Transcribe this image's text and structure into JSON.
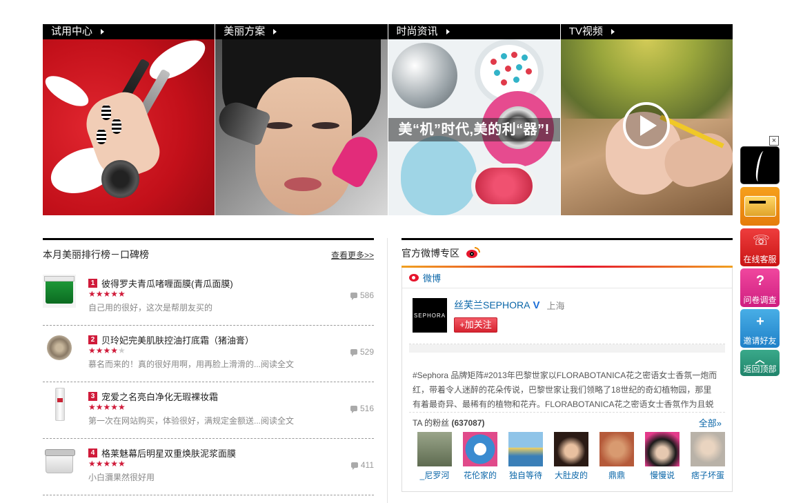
{
  "tiles": [
    {
      "label": "试用中心"
    },
    {
      "label": "美丽方案"
    },
    {
      "label": "时尚资讯",
      "caption": "美“机”时代,美的利“器”!"
    },
    {
      "label": "TV视频"
    }
  ],
  "ranking": {
    "title": "本月美丽排行榜－口碑榜",
    "more": "查看更多>>",
    "items": [
      {
        "rank": "1",
        "name": "彼得罗夫青瓜啫喱面膜(青瓜面膜)",
        "stars_on": "★★★★★",
        "stars_off": "",
        "desc": "自己用的很好，这次是帮朋友买的",
        "count": "586"
      },
      {
        "rank": "2",
        "name": "贝玲妃完美肌肤控油打底霜（猪油膏）",
        "stars_on": "★★★★",
        "stars_off": "★",
        "desc": "慕名而来的！真的很好用啊，用再脸上滑滑的...阅读全文",
        "count": "529"
      },
      {
        "rank": "3",
        "name": "宠爱之名亮白净化无瑕裸妆霜",
        "stars_on": "★★★★★",
        "stars_off": "",
        "desc": "第一次在网站购买，体验很好，满规定金额送...阅读全文",
        "count": "516"
      },
      {
        "rank": "4",
        "name": "格莱魅幕后明星双重焕肤泥浆面膜",
        "stars_on": "★★★★★",
        "stars_off": "",
        "desc": "小白瀰果然很好用",
        "count": "411"
      }
    ]
  },
  "weibo": {
    "title": "官方微博专区",
    "sub_label": "微博",
    "profile": {
      "avatar_text": "SEPHORA",
      "name": "丝芙兰SEPHORA",
      "vip": "V",
      "location": "上海",
      "follow": "+加关注"
    },
    "feed_text": "#Sephora 品牌矩阵#2013年巴黎世家以FLORABOTANICA花之密语女士香氛一炮而红，带着令人迷醉的花朵传说，巴黎世家让我们领略了18世纪的奇幻植物园，那里有着最奇异、最稀有的植物和花卉。FLORABOTANICA花之密语女士香氛作为且蜕县",
    "fans_label": "TA 的粉丝",
    "fans_count": "(637087)",
    "fans_all": "全部»",
    "fans": [
      {
        "name": "_尼罗河",
        "color": "#7d8a6d"
      },
      {
        "name": "花伦家的",
        "color": "#3a8bd0"
      },
      {
        "name": "独自等待",
        "color": "#8fc4e8"
      },
      {
        "name": "大肚皮的",
        "color": "#5a3a2e"
      },
      {
        "name": "鼎鼎",
        "color": "#c27a5a"
      },
      {
        "name": "慢慢说",
        "color": "#2a2a2a"
      },
      {
        "name": "痞子坏蛋",
        "color": "#b9b2a8"
      }
    ]
  },
  "float_bar": {
    "close": "×",
    "online": "在线客服",
    "survey": "问卷调查",
    "invite": "邀请好友",
    "top": "返回顶部"
  }
}
